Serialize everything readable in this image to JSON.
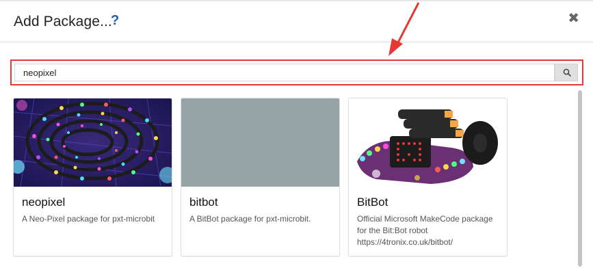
{
  "dialog": {
    "title": "Add Package...",
    "help_icon": "?",
    "close_icon": "✖"
  },
  "search": {
    "value": "neopixel",
    "button_icon": "search-icon"
  },
  "cards": [
    {
      "name": "neopixel",
      "description": "A Neo-Pixel package for pxt-microbit",
      "image": "neopixel-led-strip-photo"
    },
    {
      "name": "bitbot",
      "description": "A BitBot package for pxt-microbit.",
      "image": "placeholder",
      "image_color": "#95a5a6"
    },
    {
      "name": "BitBot",
      "description": "Official Microsoft MakeCode package for the Bit:Bot robot https://4tronix.co.uk/bitbot/",
      "image": "bitbot-robot-photo"
    }
  ],
  "colors": {
    "highlight": "#e53935",
    "accent": "#1f5fa8"
  }
}
